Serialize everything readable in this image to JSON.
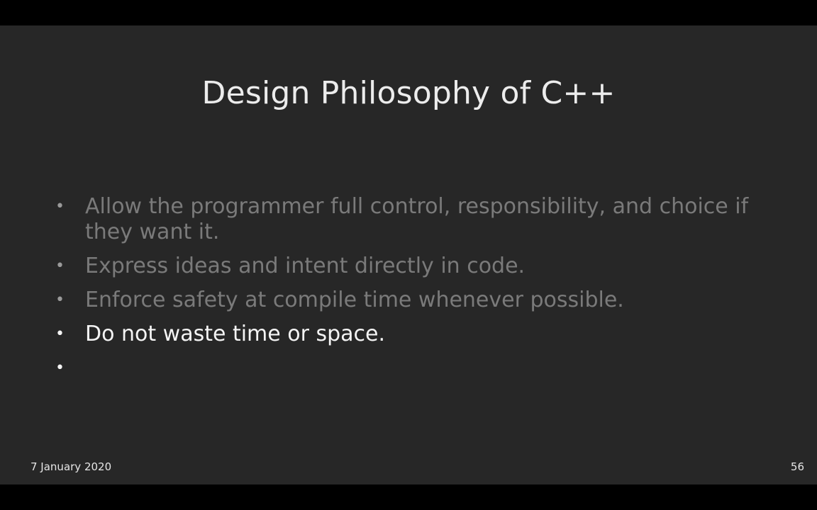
{
  "slide": {
    "title": "Design Philosophy of C++",
    "bullet_glyph": "•",
    "bullets": [
      {
        "text": "Allow the programmer full control, responsibility, and choice if they want it.",
        "state": "dim"
      },
      {
        "text": "Express ideas and intent directly in code.",
        "state": "dim"
      },
      {
        "text": "Enforce safety at compile time whenever possible.",
        "state": "dim"
      },
      {
        "text": "Do not waste time or space.",
        "state": "active"
      },
      {
        "text": "",
        "state": "empty"
      }
    ],
    "footer_date": "7 January 2020",
    "page_number": "56"
  },
  "colors": {
    "slide_background": "#272727",
    "letterbox": "#000000",
    "dim_text": "#7a7a7a",
    "active_text": "#f4f4f4"
  }
}
